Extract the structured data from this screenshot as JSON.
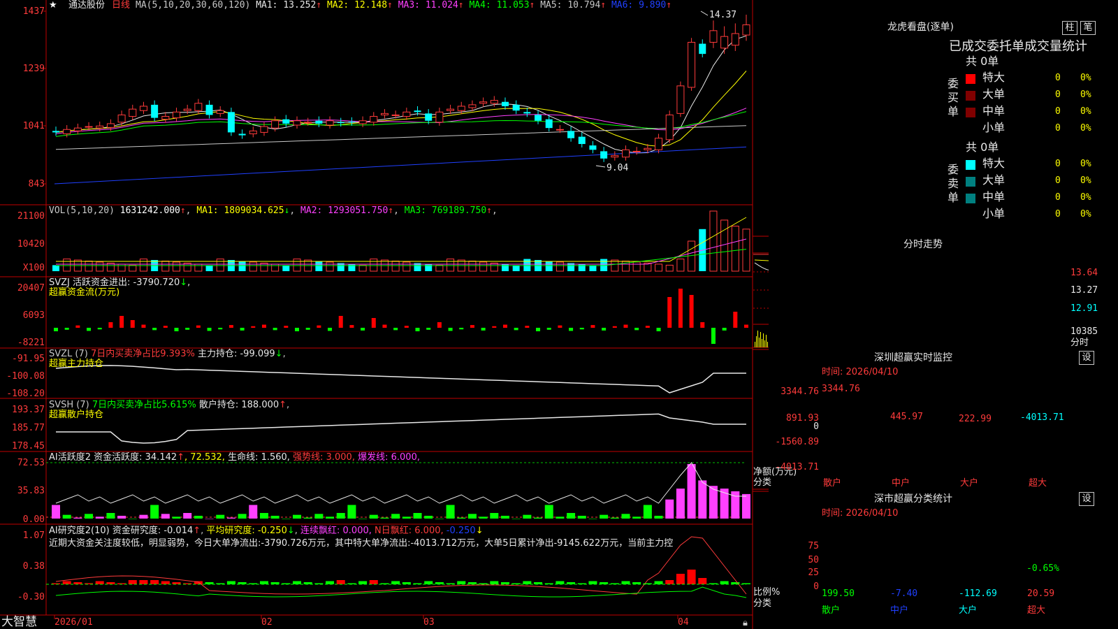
{
  "stock": {
    "name": "通达股份",
    "period": "日线",
    "star": "★"
  },
  "panels": {
    "kline": {
      "ma_label": "MA(5,10,20,30,60,120)",
      "ma": [
        {
          "t": "MA1: 13.252",
          "c": "#e8e8e8"
        },
        {
          "t": "MA2: 12.148",
          "c": "#ffff00"
        },
        {
          "t": "MA3: 11.024",
          "c": "#ff40ff"
        },
        {
          "t": "MA4: 11.053",
          "c": "#00ff00"
        },
        {
          "t": "MA5: 10.794",
          "c": "#c8c8c8"
        },
        {
          "t": "MA6: 9.890",
          "c": "#2040ff"
        }
      ],
      "axis": [
        "1437",
        "1239",
        "1041",
        "843"
      ],
      "high_mark": "14.37",
      "low_mark": "9.04"
    },
    "vol": {
      "header_a": "VOL(5,10,20)",
      "header_b": "1631242.000",
      "ma": [
        {
          "t": "MA1: 1809034.625",
          "c": "#ffff00"
        },
        {
          "t": "MA2: 1293051.750",
          "c": "#ff40ff"
        },
        {
          "t": "MA3: 769189.750",
          "c": "#00ff00"
        }
      ],
      "axis": [
        "21100",
        "10420"
      ],
      "unit": "X100"
    },
    "svzj": {
      "header": "SVZJ  活跃资金进出: -3790.720",
      "sub": "超赢资金流(万元)",
      "axis": [
        "20407",
        "6093",
        "-8221"
      ]
    },
    "svzl": {
      "header_a": "SVZL (7)",
      "header_b": "7日内买卖净占比9.393%",
      "header_c": "主力持仓: -99.099",
      "sub": "超赢主力持仓",
      "axis": [
        "-91.95",
        "-100.08",
        "-108.20"
      ]
    },
    "svsh": {
      "header_a": "SVSH (7)",
      "header_b": "7日内买卖净占比5.615%",
      "header_c": "散户持仓: 188.000",
      "sub": "超赢散户持仓",
      "axis": [
        "193.37",
        "185.77",
        "178.45"
      ]
    },
    "ai1": {
      "header_a": "AI活跃度2 资金活跃度: 34.142",
      "header_b": ", 72.532,",
      "header_c": "生命线: 1.560,",
      "header_d": "强势线: 3.000,",
      "header_e": "爆发线: 6.000,",
      "axis": [
        "72.53",
        "35.83",
        "0.00"
      ]
    },
    "ai2": {
      "header_a": "AI研究度2(10) 资金研究度: -0.014",
      "header_b": "平均研究度: -0.250",
      "header_c": "连续飘红: 0.000,",
      "header_d": "N日飘红: 6.000,",
      "header_e": "-0.250",
      "comment": "近期大资金关注度较低，明显弱势，今日大单净流出:-3790.726万元，其中特大单净流出:-4013.712万元，大单5日累计净出-9145.622万元，当前主力控",
      "axis": [
        "1.07",
        "0.38",
        "-0.30"
      ]
    }
  },
  "date_axis": [
    "2026/01",
    "02",
    "03",
    "04"
  ],
  "brand": "大智慧",
  "dragon": {
    "title": "龙虎看盘(逐单)",
    "btn_zhu": "柱",
    "btn_bi": "笔",
    "stat_title": "已成交委托单成交量统计",
    "buy": {
      "side": "委买单",
      "total": "共 0单",
      "rows": [
        {
          "name": "特大",
          "val": "0",
          "pct": "0%",
          "color": "#ff0000"
        },
        {
          "name": "大单",
          "val": "0",
          "pct": "0%",
          "color": "#800000"
        },
        {
          "name": "中单",
          "val": "0",
          "pct": "0%",
          "color": "#800000"
        },
        {
          "name": "小单",
          "val": "0",
          "pct": "0%",
          "color": "#000000"
        }
      ]
    },
    "sell": {
      "side": "委卖单",
      "total": "共 0单",
      "rows": [
        {
          "name": "特大",
          "val": "0",
          "pct": "0%",
          "color": "#00ffff"
        },
        {
          "name": "大单",
          "val": "0",
          "pct": "0%",
          "color": "#008080"
        },
        {
          "name": "中单",
          "val": "0",
          "pct": "0%",
          "color": "#008080"
        },
        {
          "name": "小单",
          "val": "0",
          "pct": "0%",
          "color": "#000000"
        }
      ]
    }
  },
  "intraday": {
    "title": "分时走势",
    "axis": [
      "13.64",
      "13.27",
      "12.91"
    ],
    "vol_axis": [
      "10385",
      "分时"
    ]
  },
  "monitor": {
    "title": "深圳超赢实时监控",
    "btn": "设",
    "time": "时间: 2026/04/10",
    "axis": [
      "3344.76",
      "891.93",
      "0",
      "-1560.89",
      "-4013.71"
    ],
    "bars": [
      {
        "cat": "散户",
        "v": 3344.76,
        "label": "3344.76"
      },
      {
        "cat": "中户",
        "v": 445.97,
        "label": "445.97"
      },
      {
        "cat": "大户",
        "v": 222.99,
        "label": "222.99"
      },
      {
        "cat": "超大",
        "v": -4013.71,
        "label": "-4013.71"
      }
    ],
    "ylabel": "净额(万元)",
    "xlabel": "分类"
  },
  "classify": {
    "title": "深市超赢分类统计",
    "btn": "设",
    "time": "时间: 2026/04/10",
    "axis": [
      "75",
      "50",
      "25",
      "0"
    ],
    "bars": [
      {
        "cat": "散户",
        "v": 199.5,
        "label": "199.50"
      },
      {
        "cat": "中户",
        "v": -7.4,
        "label": "-7.40"
      },
      {
        "cat": "大户",
        "v": -112.69,
        "label": "-112.69"
      },
      {
        "cat": "超大",
        "v": 20.59,
        "label": "20.59",
        "top": "-0.65%"
      }
    ],
    "ylabel": "比例%",
    "xlabel": "分类"
  },
  "chart_data": {
    "type": "candlestick",
    "title": "通达股份 日线",
    "x": [
      "2026/01",
      "02",
      "03",
      "04"
    ],
    "ylim": [
      8.43,
      14.37
    ],
    "high": 14.37,
    "low": 9.04,
    "ma": {
      "MA1": 13.252,
      "MA2": 12.148,
      "MA3": 11.024,
      "MA4": 11.053,
      "MA5": 10.794,
      "MA6": 9.89
    }
  }
}
